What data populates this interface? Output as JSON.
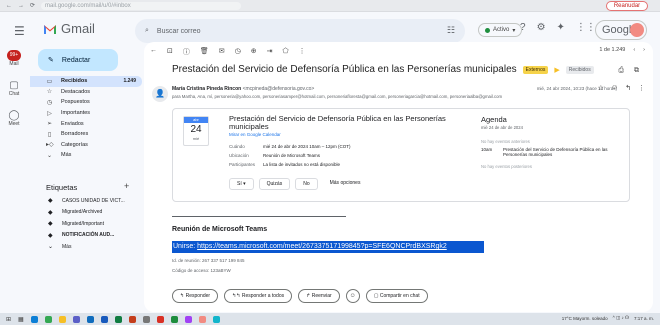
{
  "browser": {
    "url": "mail.google.com/mail/u/0/#inbox",
    "tab_pill": "Reanudar"
  },
  "app": {
    "name": "Gmail"
  },
  "search": {
    "placeholder": "Buscar correo"
  },
  "status": {
    "label": "Activo"
  },
  "account": {
    "brand": "Google"
  },
  "rail": [
    {
      "icon": "mail-icon",
      "label": "Mail",
      "badge": "99+"
    },
    {
      "icon": "chat-icon",
      "label": "Chat"
    },
    {
      "icon": "meet-icon",
      "label": "Meet"
    }
  ],
  "compose": {
    "label": "Redactar"
  },
  "nav": [
    {
      "icon": "inbox-icon",
      "label": "Recibidos",
      "count": "1.249",
      "selected": true
    },
    {
      "icon": "star-icon",
      "label": "Destacados"
    },
    {
      "icon": "clock-icon",
      "label": "Pospuestos"
    },
    {
      "icon": "important-icon",
      "label": "Importantes"
    },
    {
      "icon": "send-icon",
      "label": "Enviados"
    },
    {
      "icon": "draft-icon",
      "label": "Borradores"
    },
    {
      "icon": "category-icon",
      "label": "Categorías"
    },
    {
      "icon": "chevron-down-icon",
      "label": "Más"
    }
  ],
  "labels": {
    "title": "Etiquetas",
    "items": [
      {
        "label": "CASOS UNIDAD DE VICT..."
      },
      {
        "label": "Migrated/Archived"
      },
      {
        "label": "Migrated/Important"
      },
      {
        "label": "NOTIFICACIÓN AUD..."
      },
      {
        "label": "Más"
      }
    ]
  },
  "pager": {
    "range": "1 de 1.249"
  },
  "email": {
    "subject": "Prestación del Servicio de Defensoría Pública en las Personerías municipales",
    "tag_external": "Externos",
    "tag_inbox": "Recibidos",
    "sender_name": "María Cristina Pineda Rincon",
    "sender_email": "<mcpineda@defensoria.gov.co>",
    "to": "para Martha, Ana, mí, personeria@yahoo.com, personeriasamper@hotmail.com, personeriafloresta@gmail.com, personeriagarcia@hotmail.com, personeriaalba@gmail.com",
    "date": "mié, 24 abr 2024, 10:23 (hace 13 horas)"
  },
  "event": {
    "month": "abr",
    "day": "24",
    "weekday": "mié",
    "title": "Prestación del Servicio de Defensoría Pública en las Personerías municipales",
    "calendar_link": "Mirar en Google Calendar",
    "rows": [
      {
        "key": "Cuándo",
        "value": "mié 24 de abr de 2024 10am – 12pm (COT)"
      },
      {
        "key": "Ubicación",
        "value": "Reunión de Microsoft Teams"
      },
      {
        "key": "Participantes",
        "value": "La lista de invitados no está disponible"
      }
    ],
    "rsvp": {
      "yes": "Sí",
      "maybe": "Quizás",
      "no": "No",
      "more": "Más opciones"
    }
  },
  "agenda": {
    "title": "Agenda",
    "date": "mié 24 de abr de 2024",
    "no_prev": "No hay eventos anteriores",
    "event_time": "10am",
    "event_title": "Prestación del Servicio de Defensoría Pública en las Personerías municipales",
    "no_next": "No hay eventos posteriores"
  },
  "meeting": {
    "heading": "Reunión de Microsoft Teams",
    "join_label": "Unirse:",
    "join_url": "https://teams.microsoft.com/meet/267337517199845?p=SFE6QNCPrdBXSRgk2",
    "meeting_id": "Id. de reunión: 267 337 517 199 845",
    "passcode": "Código de acceso: 123aBYW"
  },
  "actions": {
    "reply": "Responder",
    "reply_all": "Responder a todos",
    "forward": "Reenviar",
    "share_chat": "Compartir en chat"
  },
  "taskbar": {
    "weather": "17°C Mayorm. soleado",
    "time": "7:17 a. m."
  }
}
